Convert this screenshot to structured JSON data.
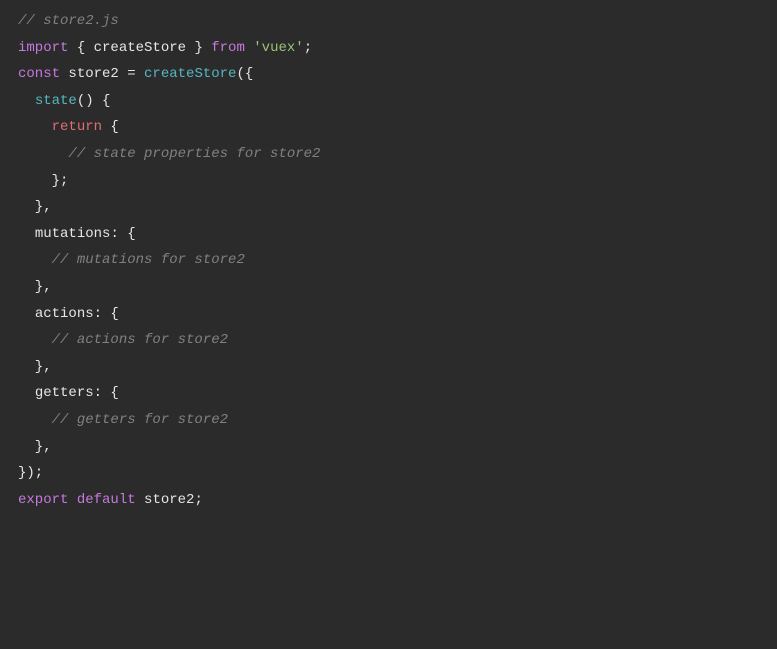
{
  "code": {
    "lines": [
      [
        {
          "cls": "tok-comment",
          "text": "// store2.js"
        }
      ],
      [
        {
          "cls": "tok-keyword",
          "text": "import"
        },
        {
          "cls": "tok-default",
          "text": " { createStore } "
        },
        {
          "cls": "tok-keyword",
          "text": "from"
        },
        {
          "cls": "tok-default",
          "text": " "
        },
        {
          "cls": "tok-string",
          "text": "'vuex'"
        },
        {
          "cls": "tok-punct",
          "text": ";"
        }
      ],
      [
        {
          "cls": "tok-default",
          "text": ""
        }
      ],
      [
        {
          "cls": "tok-keyword",
          "text": "const"
        },
        {
          "cls": "tok-default",
          "text": " store2 = "
        },
        {
          "cls": "tok-builtin",
          "text": "createStore"
        },
        {
          "cls": "tok-punct",
          "text": "({"
        }
      ],
      [
        {
          "cls": "tok-default",
          "text": "  "
        },
        {
          "cls": "tok-builtin",
          "text": "state"
        },
        {
          "cls": "tok-punct",
          "text": "() {"
        }
      ],
      [
        {
          "cls": "tok-default",
          "text": "    "
        },
        {
          "cls": "tok-return",
          "text": "return"
        },
        {
          "cls": "tok-default",
          "text": " {"
        }
      ],
      [
        {
          "cls": "tok-default",
          "text": "      "
        },
        {
          "cls": "tok-comment",
          "text": "// state properties for store2"
        }
      ],
      [
        {
          "cls": "tok-default",
          "text": "    };"
        }
      ],
      [
        {
          "cls": "tok-default",
          "text": "  },"
        }
      ],
      [
        {
          "cls": "tok-default",
          "text": "  "
        },
        {
          "cls": "tok-prop",
          "text": "mutations"
        },
        {
          "cls": "tok-punct",
          "text": ": {"
        }
      ],
      [
        {
          "cls": "tok-default",
          "text": "    "
        },
        {
          "cls": "tok-comment",
          "text": "// mutations for store2"
        }
      ],
      [
        {
          "cls": "tok-default",
          "text": "  },"
        }
      ],
      [
        {
          "cls": "tok-default",
          "text": "  "
        },
        {
          "cls": "tok-prop",
          "text": "actions"
        },
        {
          "cls": "tok-punct",
          "text": ": {"
        }
      ],
      [
        {
          "cls": "tok-default",
          "text": "    "
        },
        {
          "cls": "tok-comment",
          "text": "// actions for store2"
        }
      ],
      [
        {
          "cls": "tok-default",
          "text": "  },"
        }
      ],
      [
        {
          "cls": "tok-default",
          "text": "  "
        },
        {
          "cls": "tok-prop",
          "text": "getters"
        },
        {
          "cls": "tok-punct",
          "text": ": {"
        }
      ],
      [
        {
          "cls": "tok-default",
          "text": "    "
        },
        {
          "cls": "tok-comment",
          "text": "// getters for store2"
        }
      ],
      [
        {
          "cls": "tok-default",
          "text": "  },"
        }
      ],
      [
        {
          "cls": "tok-default",
          "text": "});"
        }
      ],
      [
        {
          "cls": "tok-default",
          "text": ""
        }
      ],
      [
        {
          "cls": "tok-keyword",
          "text": "export"
        },
        {
          "cls": "tok-default",
          "text": " "
        },
        {
          "cls": "tok-keyword",
          "text": "default"
        },
        {
          "cls": "tok-default",
          "text": " store2;"
        }
      ]
    ]
  }
}
